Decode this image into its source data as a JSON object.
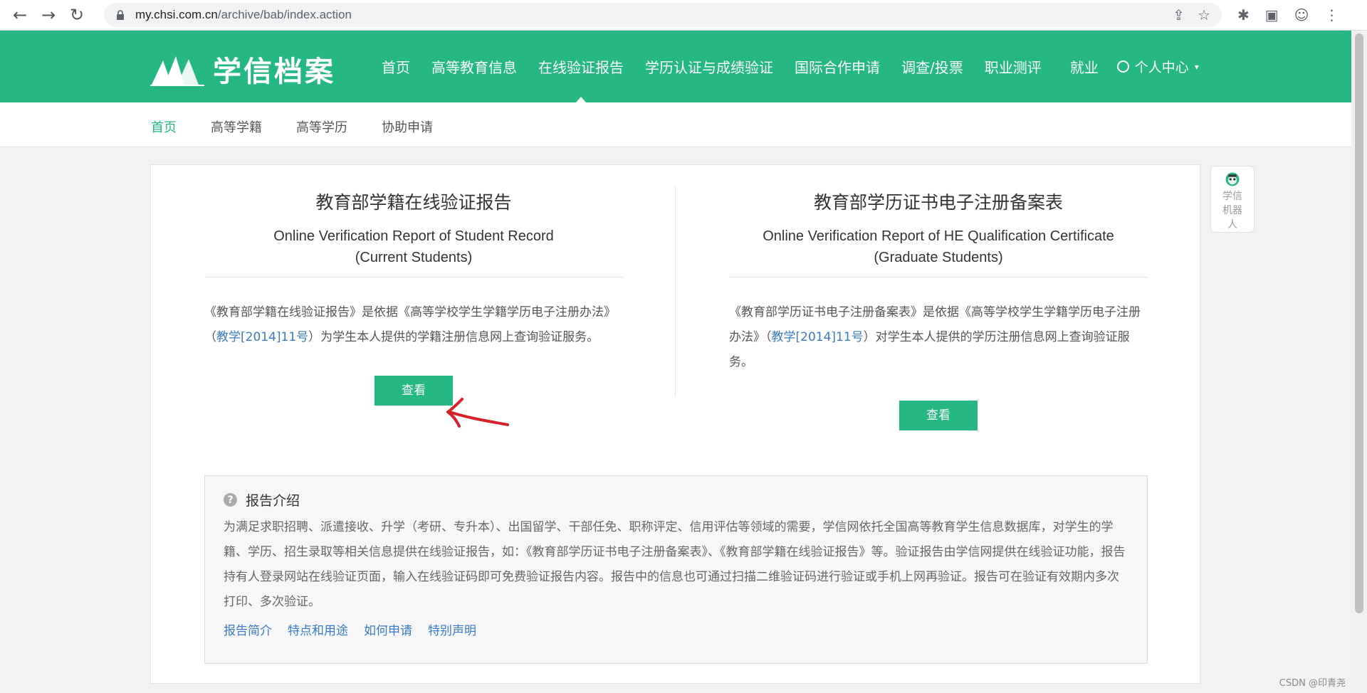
{
  "browser": {
    "url_domain": "my.chsi.com.cn",
    "url_path": "/archive/bab/index.action"
  },
  "header": {
    "logo_text": "学信档案",
    "nav": [
      {
        "label": "首页"
      },
      {
        "label": "高等教育信息"
      },
      {
        "label": "在线验证报告"
      },
      {
        "label": "学历认证与成绩验证"
      },
      {
        "label": "国际合作申请"
      },
      {
        "label": "调查/投票"
      },
      {
        "label": "职业测评"
      },
      {
        "label": "就业"
      }
    ],
    "active_nav": "在线验证报告",
    "user_center": "个人中心"
  },
  "sub_nav": {
    "items": [
      {
        "label": "首页"
      },
      {
        "label": "高等学籍"
      },
      {
        "label": "高等学历"
      },
      {
        "label": "协助申请"
      }
    ],
    "active": "首页"
  },
  "left_card": {
    "title": "教育部学籍在线验证报告",
    "en_line1": "Online Verification Report of Student Record",
    "en_line2": "(Current Students)",
    "desc_before": "《教育部学籍在线验证报告》是依据《高等学校学生学籍学历电子注册办法》（",
    "desc_link": "教学[2014]11号",
    "desc_after": "）为学生本人提供的学籍注册信息网上查询验证服务。",
    "button": "查看"
  },
  "right_card": {
    "title": "教育部学历证书电子注册备案表",
    "en_line1": "Online Verification Report of HE Qualification Certificate",
    "en_line2": "(Graduate Students)",
    "desc_before": "《教育部学历证书电子注册备案表》是依据《高等学校学生学籍学历电子注册办法》（",
    "desc_link": "教学[2014]11号",
    "desc_after": "）对学生本人提供的学历注册信息网上查询验证服务。",
    "button": "查看"
  },
  "intro": {
    "title": "报告介绍",
    "text": "为满足求职招聘、派遣接收、升学（考研、专升本）、出国留学、干部任免、职称评定、信用评估等领域的需要，学信网依托全国高等教育学生信息数据库，对学生的学籍、学历、招生录取等相关信息提供在线验证报告，如：《教育部学历证书电子注册备案表》、《教育部学籍在线验证报告》等。验证报告由学信网提供在线验证功能，报告持有人登录网站在线验证页面，输入在线验证码即可免费验证报告内容。报告中的信息也可通过扫描二维验证码进行验证或手机上网再验证。报告可在验证有效期内多次打印、多次验证。",
    "links": [
      {
        "label": "报告简介"
      },
      {
        "label": "特点和用途"
      },
      {
        "label": "如何申请"
      },
      {
        "label": "特别声明"
      }
    ]
  },
  "robot": {
    "label": "学信机器人"
  },
  "watermark": "CSDN @印青尧",
  "colors": {
    "brand_green": "#26b882",
    "link_blue": "#3a7ac6",
    "arrow_red": "#d6202a"
  }
}
